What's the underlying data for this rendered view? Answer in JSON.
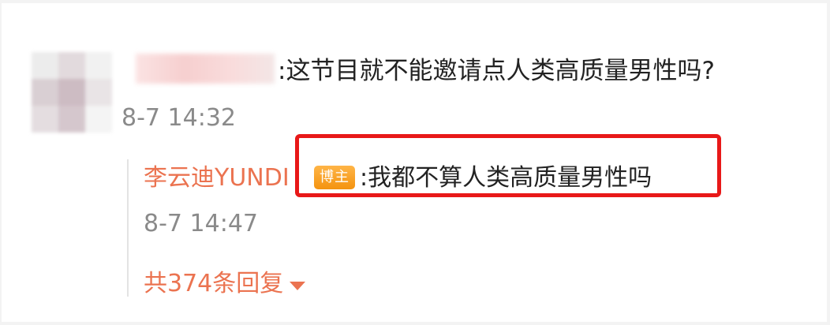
{
  "comment": {
    "text": ":这节目就不能邀请点人类高质量男性吗?",
    "time": "8-7 14:32"
  },
  "reply": {
    "author": "李云迪YUNDI",
    "badge": "博主",
    "text": ":我都不算人类高质量男性吗",
    "time": "8-7 14:47"
  },
  "more_replies": {
    "label": "共374条回复",
    "icon": "caret-down-icon"
  },
  "colors": {
    "accent": "#eb7350",
    "highlight": "#e81818",
    "badge": "#f4930f",
    "meta_text": "#8a8a8a"
  }
}
